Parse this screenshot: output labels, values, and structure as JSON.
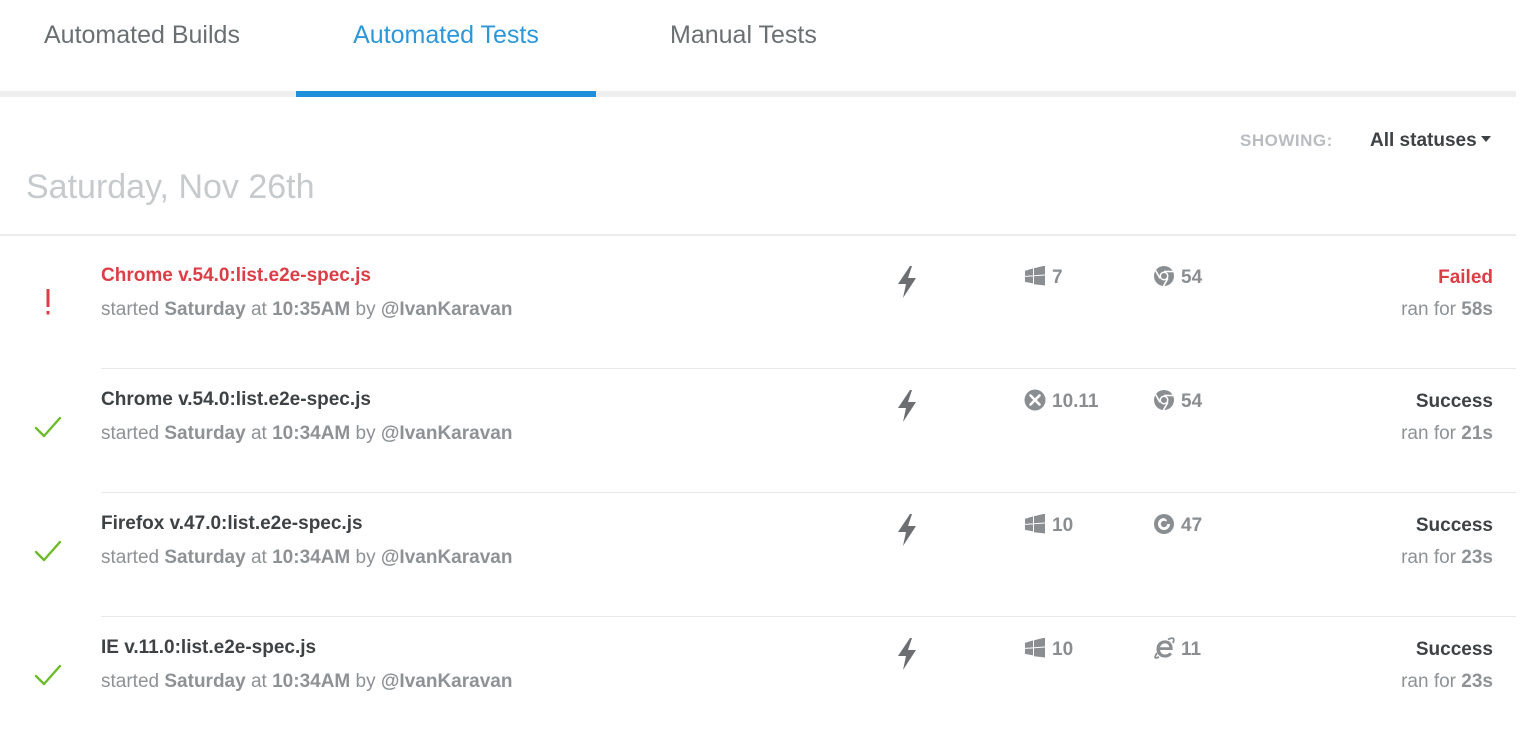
{
  "tabs": [
    {
      "label": "Automated Builds",
      "active": false
    },
    {
      "label": "Automated Tests",
      "active": true
    },
    {
      "label": "Manual Tests",
      "active": false
    }
  ],
  "filter": {
    "label": "SHOWING:",
    "value": "All statuses"
  },
  "date_heading": "Saturday, Nov 26th",
  "colors": {
    "accent": "#1f8fdb",
    "failed": "#dc3e45",
    "success": "#6dbb2a"
  },
  "runs": [
    {
      "title": "Chrome v.54.0:list.e2e-spec.js",
      "started_prefix": "started",
      "day": "Saturday",
      "at": "at",
      "time": "10:35AM",
      "by": "by",
      "user": "@IvanKaravan",
      "trigger_icon": "bolt-icon",
      "os_icon": "windows-icon",
      "os_version": "7",
      "browser_icon": "chrome-icon",
      "browser_version": "54",
      "status": "Failed",
      "status_icon": "exclamation-icon",
      "ran_for_label": "ran for",
      "duration": "58s"
    },
    {
      "title": "Chrome v.54.0:list.e2e-spec.js",
      "started_prefix": "started",
      "day": "Saturday",
      "at": "at",
      "time": "10:34AM",
      "by": "by",
      "user": "@IvanKaravan",
      "trigger_icon": "bolt-icon",
      "os_icon": "macos-icon",
      "os_version": "10.11",
      "browser_icon": "chrome-icon",
      "browser_version": "54",
      "status": "Success",
      "status_icon": "checkmark-icon",
      "ran_for_label": "ran for",
      "duration": "21s"
    },
    {
      "title": "Firefox v.47.0:list.e2e-spec.js",
      "started_prefix": "started",
      "day": "Saturday",
      "at": "at",
      "time": "10:34AM",
      "by": "by",
      "user": "@IvanKaravan",
      "trigger_icon": "bolt-icon",
      "os_icon": "windows-icon",
      "os_version": "10",
      "browser_icon": "firefox-icon",
      "browser_version": "47",
      "status": "Success",
      "status_icon": "checkmark-icon",
      "ran_for_label": "ran for",
      "duration": "23s"
    },
    {
      "title": "IE v.11.0:list.e2e-spec.js",
      "started_prefix": "started",
      "day": "Saturday",
      "at": "at",
      "time": "10:34AM",
      "by": "by",
      "user": "@IvanKaravan",
      "trigger_icon": "bolt-icon",
      "os_icon": "windows-icon",
      "os_version": "10",
      "browser_icon": "ie-icon",
      "browser_version": "11",
      "status": "Success",
      "status_icon": "checkmark-icon",
      "ran_for_label": "ran for",
      "duration": "23s"
    }
  ]
}
